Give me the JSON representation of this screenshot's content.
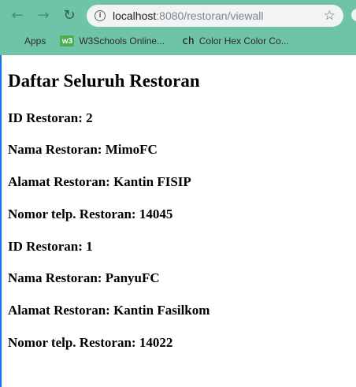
{
  "browser": {
    "back_icon": "arrow-left-icon",
    "forward_icon": "arrow-right-icon",
    "reload_icon": "reload-icon",
    "url_host": "localhost",
    "url_rest": ":8080/restoran/viewall",
    "bookmark_star_icon": "star-icon",
    "accent": "#6fc3a8"
  },
  "bookmarks": [
    {
      "label": "Apps",
      "icon": "apps-grid-icon"
    },
    {
      "label": "W3Schools Online...",
      "icon": "w3schools-icon"
    },
    {
      "label": "Color Hex Color Co...",
      "icon": "colorhex-icon"
    }
  ],
  "page": {
    "title": "Daftar Seluruh Restoran",
    "restaurants": [
      {
        "id": "ID Restoran: 2",
        "nama": "Nama Restoran: MimoFC",
        "alamat": "Alamat Restoran: Kantin FISIP",
        "telp": "Nomor telp. Restoran: 14045"
      },
      {
        "id": "ID Restoran: 1",
        "nama": "Nama Restoran: PanyuFC",
        "alamat": "Alamat Restoran: Kantin Fasilkom",
        "telp": "Nomor telp. Restoran: 14022"
      }
    ]
  }
}
